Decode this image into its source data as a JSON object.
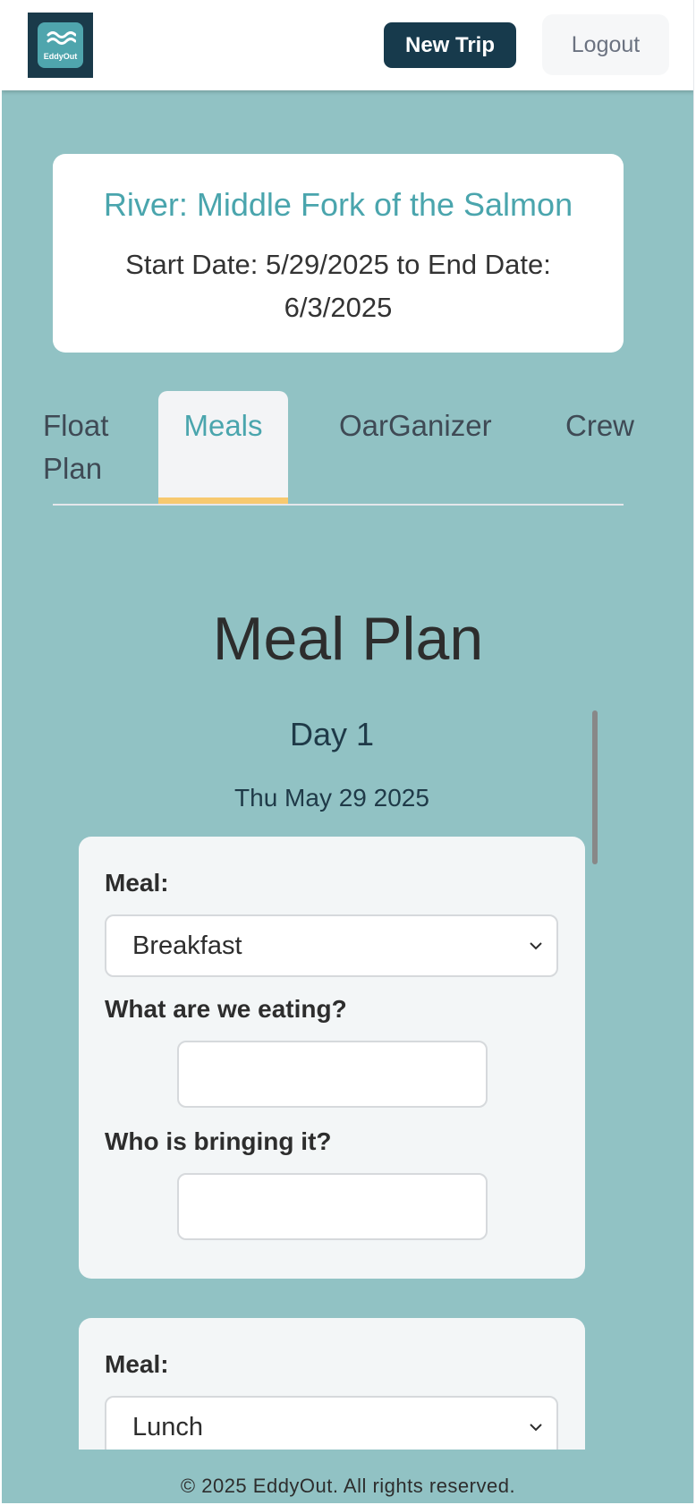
{
  "header": {
    "logo_text": "EddyOut",
    "new_trip_label": "New Trip",
    "logout_label": "Logout"
  },
  "trip": {
    "river": "River: Middle Fork of the Salmon",
    "dates": "Start Date: 5/29/2025 to End Date: 6/3/2025"
  },
  "tabs": [
    {
      "label": "Float Plan",
      "active": false
    },
    {
      "label": "Meals",
      "active": true
    },
    {
      "label": "OarGanizer",
      "active": false
    },
    {
      "label": "Crew",
      "active": false
    }
  ],
  "meal_plan": {
    "title": "Meal Plan",
    "day_title": "Day 1",
    "day_date": "Thu May 29 2025",
    "meals": [
      {
        "meal_label": "Meal:",
        "meal_value": "Breakfast",
        "eating_label": "What are we eating?",
        "eating_value": "",
        "bringing_label": "Who is bringing it?",
        "bringing_value": ""
      },
      {
        "meal_label": "Meal:",
        "meal_value": "Lunch"
      }
    ]
  },
  "footer": {
    "text": "© 2025 EddyOut. All rights reserved."
  },
  "colors": {
    "background": "#91c2c4",
    "accent": "#4aa5ad",
    "primary_button": "#173a4c",
    "active_tab_underline": "#f7c96f"
  }
}
